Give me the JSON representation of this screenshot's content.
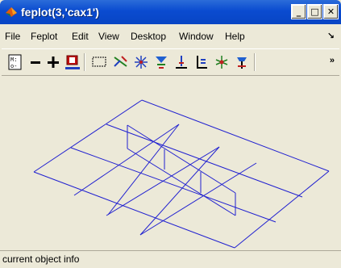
{
  "window": {
    "title": "feplot(3,'cax1')",
    "buttons": {
      "minimize": "_",
      "maximize": "□",
      "close": "✕"
    }
  },
  "menubar": {
    "items": [
      "File",
      "Feplot",
      "Edit",
      "View",
      "Desktop",
      "Window",
      "Help"
    ],
    "overflow": "↘"
  },
  "toolbar": {
    "buttons": [
      "matrix-icon",
      "minus-icon",
      "plus-icon",
      "record-icon",
      "select-rect-icon",
      "orbit-icon",
      "sparkle-icon",
      "arrows-icon",
      "triad-icon",
      "triad-anim-icon",
      "spread-icon",
      "tool-icon"
    ],
    "overflow": "»"
  },
  "plot": {
    "line_color": "#2020d0",
    "description_label": ""
  },
  "status": {
    "text": "current object info"
  }
}
